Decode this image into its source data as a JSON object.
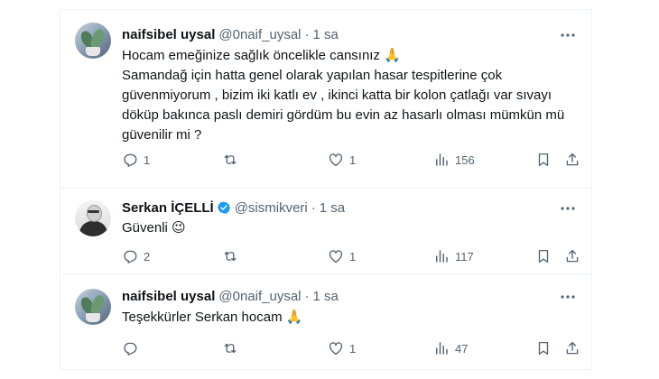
{
  "tweets": [
    {
      "name": "naifsibel uysal",
      "handle": "@0naif_uysal",
      "separator": "·",
      "time": "1 sa",
      "verified": false,
      "lines": [
        "Hocam emeğinize sağlık öncelikle cansınız 🙏",
        "Samandağ için hatta genel olarak yapılan hasar tespitlerine çok",
        "güvenmiyorum , bizim iki katlı ev ,  ikinci katta bir kolon çatlağı var sıvayı",
        "döküp bakınca paslı demiri gördüm bu evin az hasarlı olması mümkün mü",
        "güvenilir mi  ?"
      ],
      "replies": "1",
      "retweets": "",
      "likes": "1",
      "views": "156"
    },
    {
      "name": "Serkan İÇELLİ",
      "handle": "@sismikveri",
      "separator": "·",
      "time": "1 sa",
      "verified": true,
      "text": "Güvenli",
      "emoji": "😉",
      "replies": "2",
      "retweets": "",
      "likes": "1",
      "views": "117"
    },
    {
      "name": "naifsibel uysal",
      "handle": "@0naif_uysal",
      "separator": "·",
      "time": "1 sa",
      "verified": false,
      "text": "Teşekkürler Serkan hocam",
      "emoji": "🙏",
      "replies": "",
      "retweets": "",
      "likes": "1",
      "views": "47"
    }
  ],
  "colors": {
    "text": "#0f1419",
    "secondary": "#536471",
    "verified": "#1d9bf0",
    "border": "#eff3f4"
  },
  "icons": [
    "reply-icon",
    "retweet-icon",
    "like-icon",
    "views-icon",
    "bookmark-icon",
    "share-icon",
    "more-icon",
    "verified-badge-icon"
  ]
}
